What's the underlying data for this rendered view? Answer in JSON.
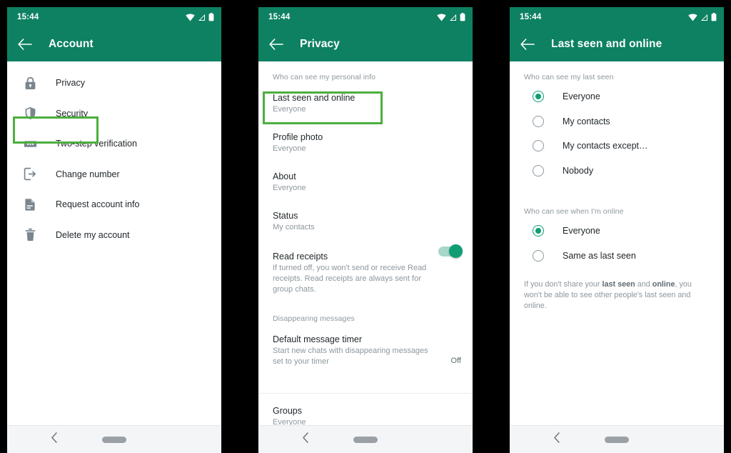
{
  "statusbar": {
    "time": "15:44",
    "icons": [
      "wifi-icon",
      "signal-icon",
      "battery-icon"
    ]
  },
  "navbar": {
    "back_icon": "chevron-left-icon",
    "home_pill": "home-pill"
  },
  "theme": {
    "appbar_green": "#0d8162",
    "accent_green": "#0f9d74",
    "highlight_green": "#4cae3f",
    "text_primary": "#1f2529",
    "text_secondary": "#8d979d",
    "icon_gray": "#7a868e"
  },
  "phone1": {
    "title": "Account",
    "back_icon": "arrow-left-icon",
    "items": [
      {
        "label": "Privacy",
        "icon": "lock-icon",
        "highlighted": true
      },
      {
        "label": "Security",
        "icon": "shield-icon",
        "highlighted": false
      },
      {
        "label": "Two-step verification",
        "icon": "pin-dots-icon",
        "highlighted": false
      },
      {
        "label": "Change number",
        "icon": "change-number-icon",
        "highlighted": false
      },
      {
        "label": "Request account info",
        "icon": "document-icon",
        "highlighted": false
      },
      {
        "label": "Delete my account",
        "icon": "trash-icon",
        "highlighted": false
      }
    ]
  },
  "phone2": {
    "title": "Privacy",
    "back_icon": "arrow-left-icon",
    "section1_header": "Who can see my personal info",
    "items": [
      {
        "title": "Last seen and online",
        "sub": "Everyone",
        "highlighted": true
      },
      {
        "title": "Profile photo",
        "sub": "Everyone",
        "highlighted": false
      },
      {
        "title": "About",
        "sub": "Everyone",
        "highlighted": false
      },
      {
        "title": "Status",
        "sub": "My contacts",
        "highlighted": false
      }
    ],
    "read_receipts": {
      "title": "Read receipts",
      "sub": "If turned off, you won't send or receive Read receipts. Read receipts are always sent for group chats.",
      "toggle_on": true
    },
    "section2_header": "Disappearing messages",
    "default_timer": {
      "title": "Default message timer",
      "sub": "Start new chats with disappearing messages set to your timer",
      "value": "Off"
    },
    "groups": {
      "title": "Groups",
      "sub": "Everyone"
    }
  },
  "phone3": {
    "title": "Last seen and online",
    "back_icon": "arrow-left-icon",
    "group1": {
      "header": "Who can see my last seen",
      "options": [
        {
          "label": "Everyone",
          "selected": true
        },
        {
          "label": "My contacts",
          "selected": false
        },
        {
          "label": "My contacts except…",
          "selected": false
        },
        {
          "label": "Nobody",
          "selected": false
        }
      ]
    },
    "group2": {
      "header": "Who can see when I'm online",
      "options": [
        {
          "label": "Everyone",
          "selected": true
        },
        {
          "label": "Same as last seen",
          "selected": false
        }
      ]
    },
    "note_parts": {
      "a": "If you don't share your ",
      "b": "last seen",
      "c": " and ",
      "d": "online",
      "e": ", you won't be able to see other people's last seen and online."
    }
  }
}
